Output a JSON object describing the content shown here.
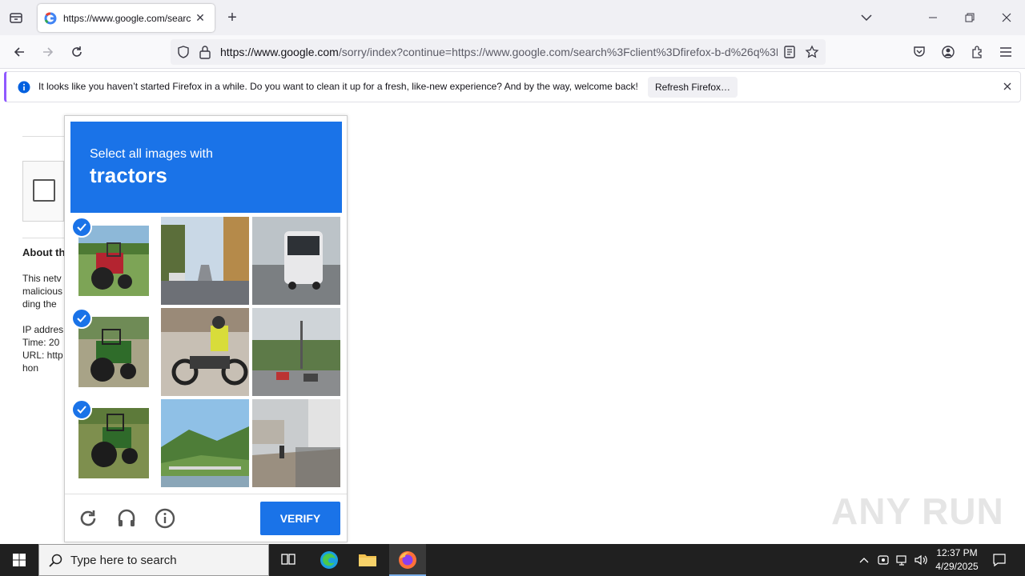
{
  "browser": {
    "tab_title": "https://www.google.com/search",
    "url_host": "https://www.google.com",
    "url_rest": "/sorry/index?continue=https://www.google.com/search%3Fclient%3Dfirefox-b-d%26q%3D",
    "infobar_text": "It looks like you haven’t started Firefox in a while. Do you want to clean it up for a fresh, like-new experience? And by the way, welcome back!",
    "infobar_button": "Refresh Firefox…"
  },
  "page": {
    "about": "About th",
    "line1": "This netv",
    "line2": "malicious",
    "line3": "ding the",
    "ip": "IP addres",
    "time": "Time: 20",
    "url": "URL: http",
    "hon": "hon"
  },
  "captcha": {
    "instruction": "Select all images with",
    "target": "tractors",
    "verify_label": "VERIFY",
    "tiles": [
      {
        "label": "tractor",
        "selected": true
      },
      {
        "label": "street",
        "selected": false
      },
      {
        "label": "bus",
        "selected": false
      },
      {
        "label": "tractor",
        "selected": true
      },
      {
        "label": "motorcycle",
        "selected": false
      },
      {
        "label": "intersection",
        "selected": false
      },
      {
        "label": "tractor",
        "selected": true
      },
      {
        "label": "hills",
        "selected": false
      },
      {
        "label": "walkway",
        "selected": false
      }
    ]
  },
  "taskbar": {
    "search_placeholder": "Type here to search",
    "time": "12:37 PM",
    "date": "4/29/2025"
  },
  "watermark": "ANY RUN",
  "colors": {
    "accent": "#1a73e8",
    "tab_bg": "#f0f0f4",
    "taskbar": "#202020"
  }
}
